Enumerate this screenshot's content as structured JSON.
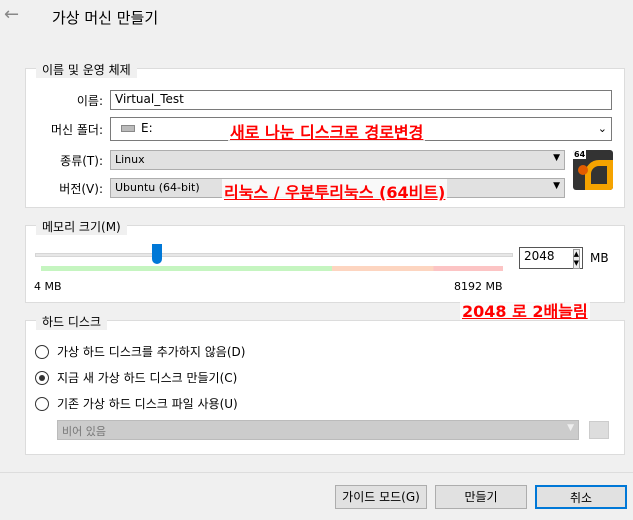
{
  "header": {
    "title": "가상 머신 만들기"
  },
  "name_os": {
    "legend": "이름 및 운영 체제",
    "name_label": "이름:",
    "name_value": "Virtual_Test",
    "folder_label": "머신 폴더:",
    "folder_value": "E:",
    "type_label": "종류(T):",
    "type_value": "Linux",
    "version_label": "버전(V):",
    "version_value": "Ubuntu (64-bit)",
    "os_badge": "64"
  },
  "memory": {
    "legend": "메모리 크기(M)",
    "value": "2048",
    "unit": "MB",
    "min_label": "4 MB",
    "max_label": "8192 MB",
    "fraction": 0.25
  },
  "disk": {
    "legend": "하드 디스크",
    "options": [
      "가상 하드 디스크를 추가하지 않음(D)",
      "지금 새 가상 하드 디스크 만들기(C)",
      "기존 가상 하드 디스크 파일 사용(U)"
    ],
    "selected": 1,
    "file_value": "비어 있음"
  },
  "annotations": [
    "새로 나눈 디스크로 경로변경",
    "리눅스 / 우분투리눅스 (64비트)",
    "2048 로  2배늘림"
  ],
  "buttons": {
    "guided": "가이드 모드(G)",
    "create": "만들기",
    "cancel": "취소"
  }
}
